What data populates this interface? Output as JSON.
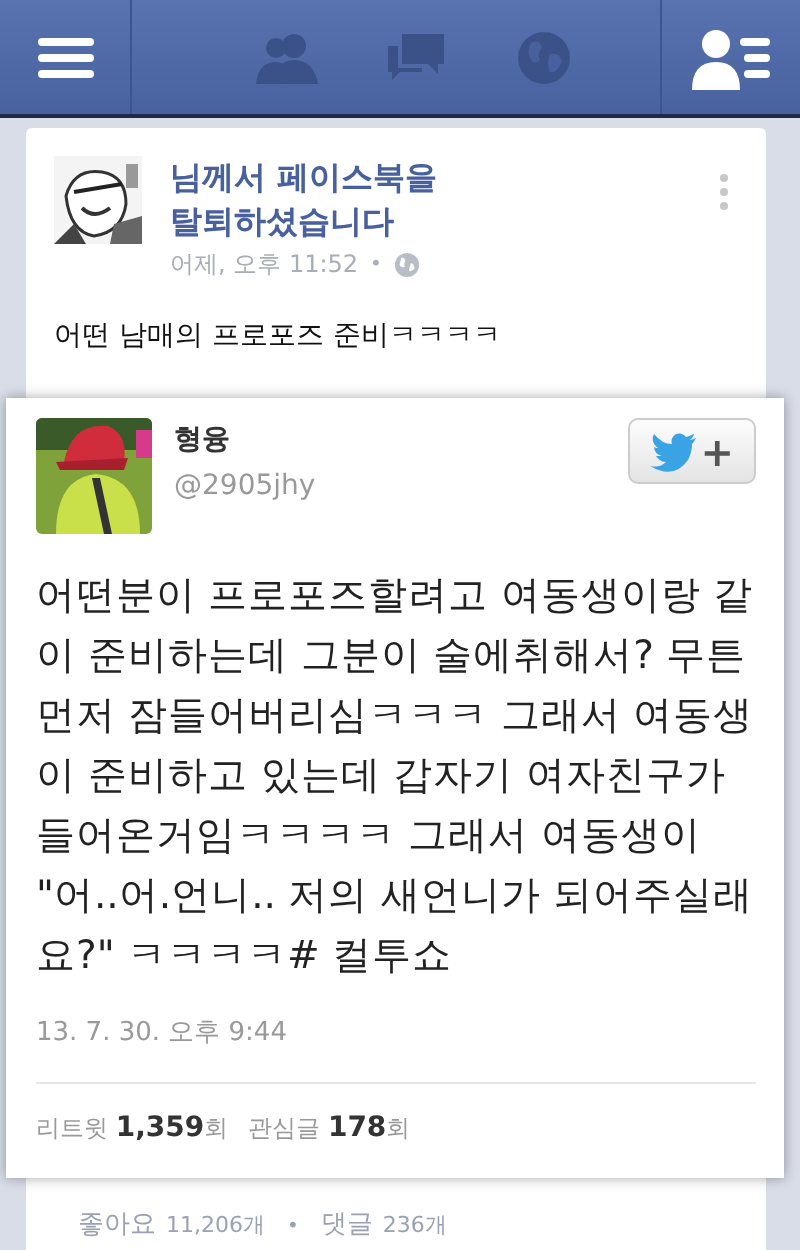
{
  "top_bar": {
    "icons": [
      {
        "kind": "menu"
      },
      {
        "kind": "friends"
      },
      {
        "kind": "messages"
      },
      {
        "kind": "globe"
      },
      {
        "kind": "profile-list"
      }
    ]
  },
  "post": {
    "author": "님께서 페이스북을 탈퇴하셨습니다",
    "time": "어제, 오후 11:52",
    "separator": "•",
    "text": "어떤 남매의 프로포즈 준비ㅋㅋㅋㅋ",
    "tweet": {
      "name": "형융",
      "handle": "@2905jhy",
      "follow_label": "+",
      "text": "어떤분이 프로포즈할려고 여동생이랑 같이 준비하는데 그분이 술에취해서? 무튼 먼저 잠들어버리심ㅋㅋㅋ 그래서 여동생이 준비하고 있는데 갑자기 여자친구가 들어온거임ㅋㅋㅋㅋ 그래서 여동생이 \"어..어.언니.. 저의 새언니가 되어주실래요?\" ㅋㅋㅋㅋ# 컬투쇼",
      "date": "13. 7. 30. 오후 9:44",
      "stats": [
        "리트윗 **1,359**회",
        "관심글 **178**회"
      ]
    },
    "footer": [
      {
        "label": "좋아요",
        "count": "11,206개"
      },
      {
        "label": "댓글",
        "count": "236개"
      }
    ],
    "footer_separator": "•"
  }
}
